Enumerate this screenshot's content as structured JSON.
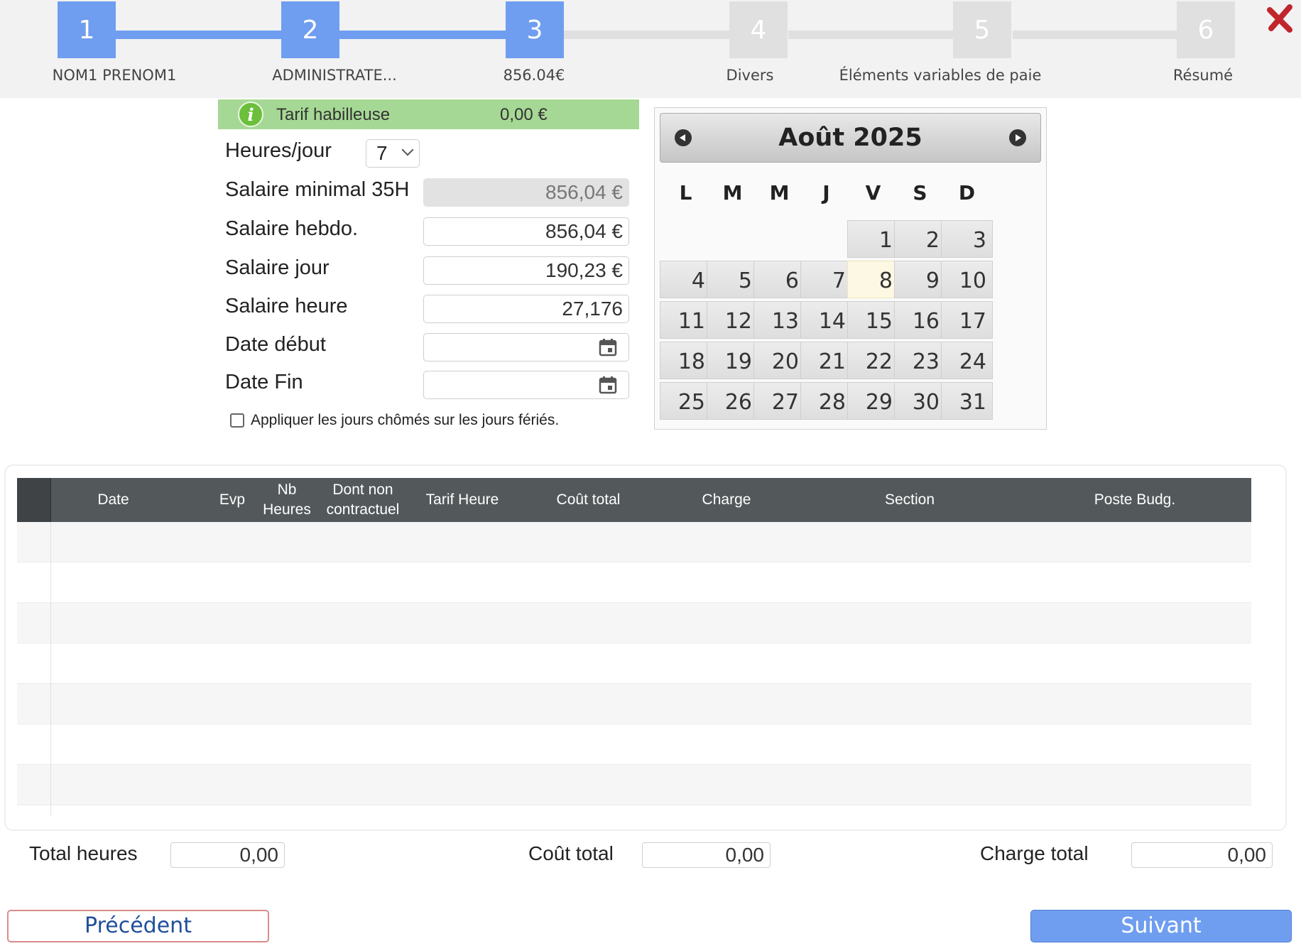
{
  "stepper": {
    "steps": [
      {
        "number": "1",
        "label": "NOM1 PRENOM1",
        "active": true
      },
      {
        "number": "2",
        "label": "ADMINISTRATE...",
        "active": true
      },
      {
        "number": "3",
        "label": "856.04€",
        "active": true
      },
      {
        "number": "4",
        "label": "Divers",
        "active": false
      },
      {
        "number": "5",
        "label": "Éléments variables de paie",
        "active": false
      },
      {
        "number": "6",
        "label": "Résumé",
        "active": false
      }
    ],
    "close_icon": "close-x-icon"
  },
  "info": {
    "icon": "info-icon",
    "icon_glyph": "i",
    "label": "Tarif habilleuse",
    "value": "0,00 €"
  },
  "form": {
    "heures_label": "Heures/jour",
    "heures_value": "7",
    "salaire_min_label": "Salaire minimal 35H",
    "salaire_min_value": "856,04 €",
    "salaire_hebdo_label": "Salaire hebdo.",
    "salaire_hebdo_value": "856,04 €",
    "salaire_jour_label": "Salaire jour",
    "salaire_jour_value": "190,23 €",
    "salaire_heure_label": "Salaire heure",
    "salaire_heure_value": "27,176",
    "date_debut_label": "Date début",
    "date_debut_value": "",
    "date_fin_label": "Date Fin",
    "date_fin_value": "",
    "checkbox_label": "Appliquer les jours chômés sur les jours fériés."
  },
  "calendar": {
    "title": "Août 2025",
    "weekdays": [
      "L",
      "M",
      "M",
      "J",
      "V",
      "S",
      "D"
    ],
    "first_weekday_index": 4,
    "days": [
      "1",
      "2",
      "3",
      "4",
      "5",
      "6",
      "7",
      "8",
      "9",
      "10",
      "11",
      "12",
      "13",
      "14",
      "15",
      "16",
      "17",
      "18",
      "19",
      "20",
      "21",
      "22",
      "23",
      "24",
      "25",
      "26",
      "27",
      "28",
      "29",
      "30",
      "31"
    ],
    "today": "8"
  },
  "table": {
    "columns": [
      {
        "key": "date",
        "label": "Date"
      },
      {
        "key": "evp",
        "label": "Evp"
      },
      {
        "key": "nb_heures",
        "label": "Nb\nHeures"
      },
      {
        "key": "dont_non",
        "label": "Dont non\ncontractuel"
      },
      {
        "key": "tarif",
        "label": "Tarif Heure"
      },
      {
        "key": "cout",
        "label": "Coût total"
      },
      {
        "key": "charge",
        "label": "Charge"
      },
      {
        "key": "section",
        "label": "Section"
      },
      {
        "key": "poste",
        "label": "Poste Budg."
      }
    ],
    "rows": []
  },
  "totals": {
    "heures_label": "Total heures",
    "heures_value": "0,00",
    "cout_label": "Coût total",
    "cout_value": "0,00",
    "charge_label": "Charge total",
    "charge_value": "0,00"
  },
  "buttons": {
    "prev_label": "Précédent",
    "next_label": "Suivant"
  },
  "colors": {
    "step_active": "#6f9ef0",
    "step_inactive": "#e0e0e0",
    "info_bar": "#a6d895",
    "table_header": "#53585b",
    "close": "#c0262c"
  }
}
